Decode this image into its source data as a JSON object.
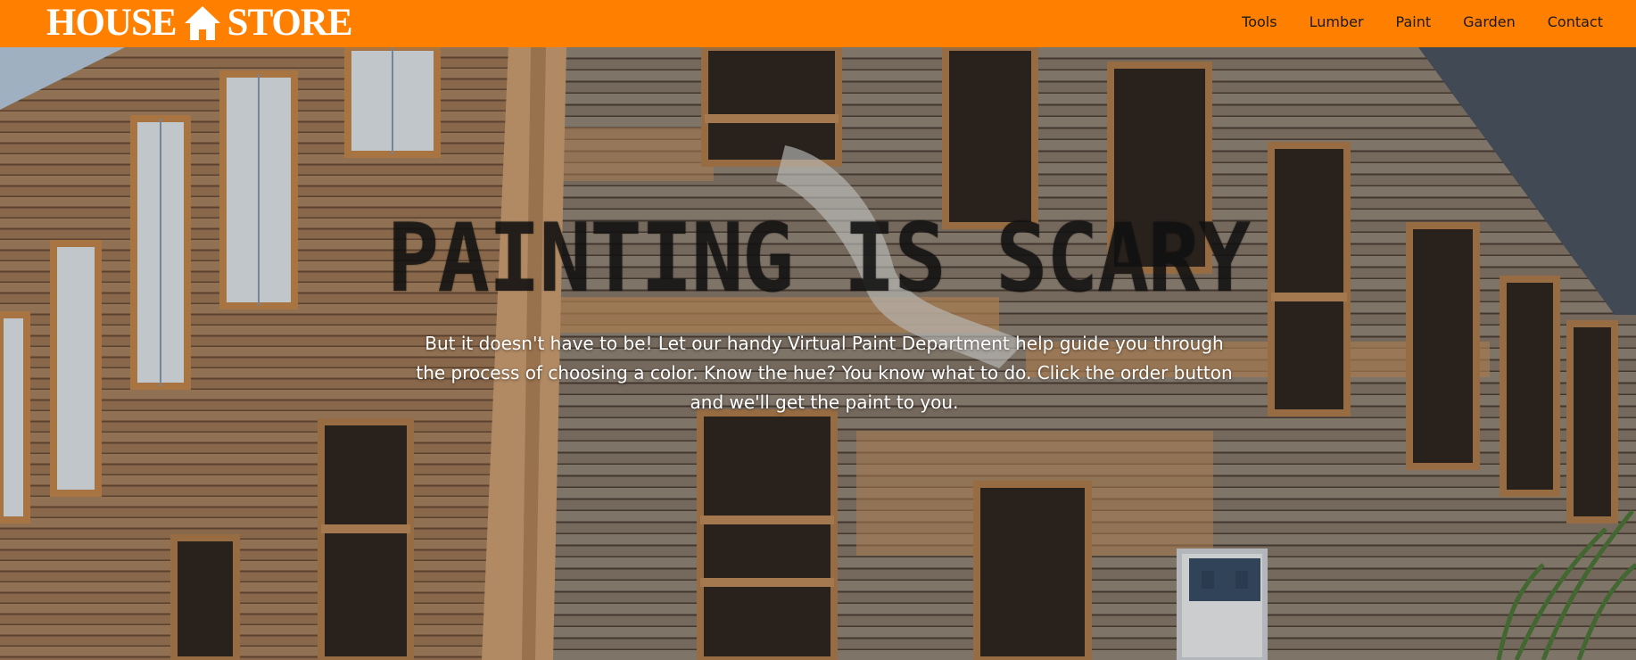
{
  "header": {
    "brand_left": "HOUSE",
    "brand_right": "STORE",
    "brand_icon": "house-icon",
    "brand_color": "#ff8000",
    "nav": {
      "tools": "Tools",
      "lumber": "Lumber",
      "paint": "Paint",
      "garden": "Garden",
      "contact": "Contact"
    }
  },
  "hero": {
    "title": "PAINTING IS SCARY",
    "body": "But it doesn't have to be! Let our handy Virtual Paint Department help guide you through the process of choosing a color. Know the hue? You know what to do. Click the order button and we'll get the paint to you."
  }
}
